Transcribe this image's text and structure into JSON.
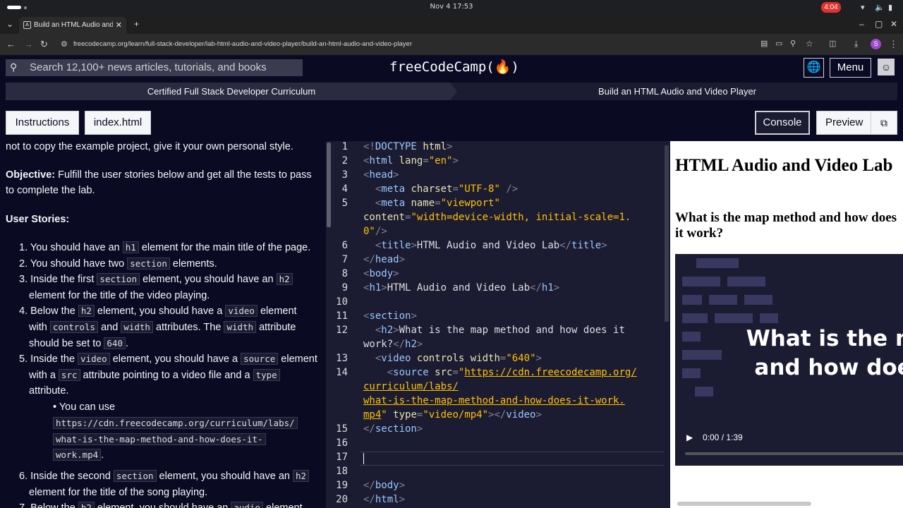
{
  "os": {
    "datetime": "Nov 4  17:53",
    "recording": "4:04"
  },
  "browser": {
    "tab_title": "Build an HTML Audio and Video Player",
    "tab_favicon": "A",
    "url": "freecodecamp.org/learn/full-stack-developer/lab-html-audio-and-video-player/build-an-html-audio-and-video-player",
    "profile_initial": "S"
  },
  "fcc_nav": {
    "search_placeholder": "Search 12,100+ news articles, tutorials, and books",
    "logo": "freeCodeCamp(🔥)",
    "menu": "Menu"
  },
  "breadcrumb": {
    "curriculum": "Certified Full Stack Developer Curriculum",
    "lab": "Build an HTML Audio and Video Player"
  },
  "panel_tabs": {
    "instructions": "Instructions",
    "file": "index.html",
    "console": "Console",
    "preview": "Preview"
  },
  "instructions": {
    "intro_tail": "not to copy the example project, give it your own personal style.",
    "objective_label": "Objective:",
    "objective_text_1": " Fulfill the user stories below and get all the tests to pass",
    "objective_text_2": "to complete the lab.",
    "user_stories_heading": "User Stories:",
    "stories": {
      "s1": {
        "n": "1.",
        "a": "You should have an ",
        "c1": "h1",
        "b": " element for the main title of the page."
      },
      "s2": {
        "n": "2.",
        "a": "You should have two ",
        "c1": "section",
        "b": " elements."
      },
      "s3": {
        "n": "3.",
        "a": "Inside the first ",
        "c1": "section",
        "b": " element, you should have an ",
        "c2": "h2",
        "l2": "element for the title of the video playing."
      },
      "s4": {
        "n": "4.",
        "a": "Below the ",
        "c1": "h2",
        "b": " element, you should have a ",
        "c2": "video",
        "d": " element",
        "l2a": "with ",
        "c3": "controls",
        "l2b": " and ",
        "c4": "width",
        "l2c": " attributes. The ",
        "c5": "width",
        "l2d": " attribute",
        "l3a": "should be set to ",
        "c6": "640",
        "l3b": "."
      },
      "s5": {
        "n": "5.",
        "a": "Inside the ",
        "c1": "video",
        "b": " element, you should have a ",
        "c2": "source",
        "d": " element",
        "l2a": "with a ",
        "c3": "src",
        "l2b": " attribute pointing to a video file and a ",
        "c4": "type",
        "l3": "attribute.",
        "bullet": "You can use",
        "url1": "https://cdn.freecodecamp.org/curriculum/labs/",
        "url2": "what-is-the-map-method-and-how-does-it-",
        "url3": "work.mp4",
        "url_tail": "."
      },
      "s6": {
        "n": "6.",
        "a": "Inside the second ",
        "c1": "section",
        "b": " element, you should have an ",
        "c2": "h2",
        "l2": "element for the title of the song playing."
      },
      "s7": {
        "n": "7.",
        "a": "Below the ",
        "c1": "h2",
        "b": " element, you should have an ",
        "c2": "audio",
        "d": " element"
      }
    }
  },
  "editor": {
    "line_numbers": [
      "1",
      "2",
      "3",
      "4",
      "5",
      "6",
      "7",
      "8",
      "9",
      "10",
      "11",
      "12",
      "13",
      "14",
      "15",
      "16",
      "17",
      "18",
      "19",
      "20"
    ]
  },
  "preview": {
    "h1": "HTML Audio and Video Lab",
    "h2": "What is the map method and how does it work?",
    "video_overlay_1": "What is the map",
    "video_overlay_2": "and how does i",
    "video_time": "0:00 / 1:39"
  },
  "colors": {
    "bg": "#0a0a23",
    "editor_bg": "#1b1b32",
    "tag": "#99c9ff",
    "attr": "#e6e6b5",
    "string": "#ffc300"
  }
}
